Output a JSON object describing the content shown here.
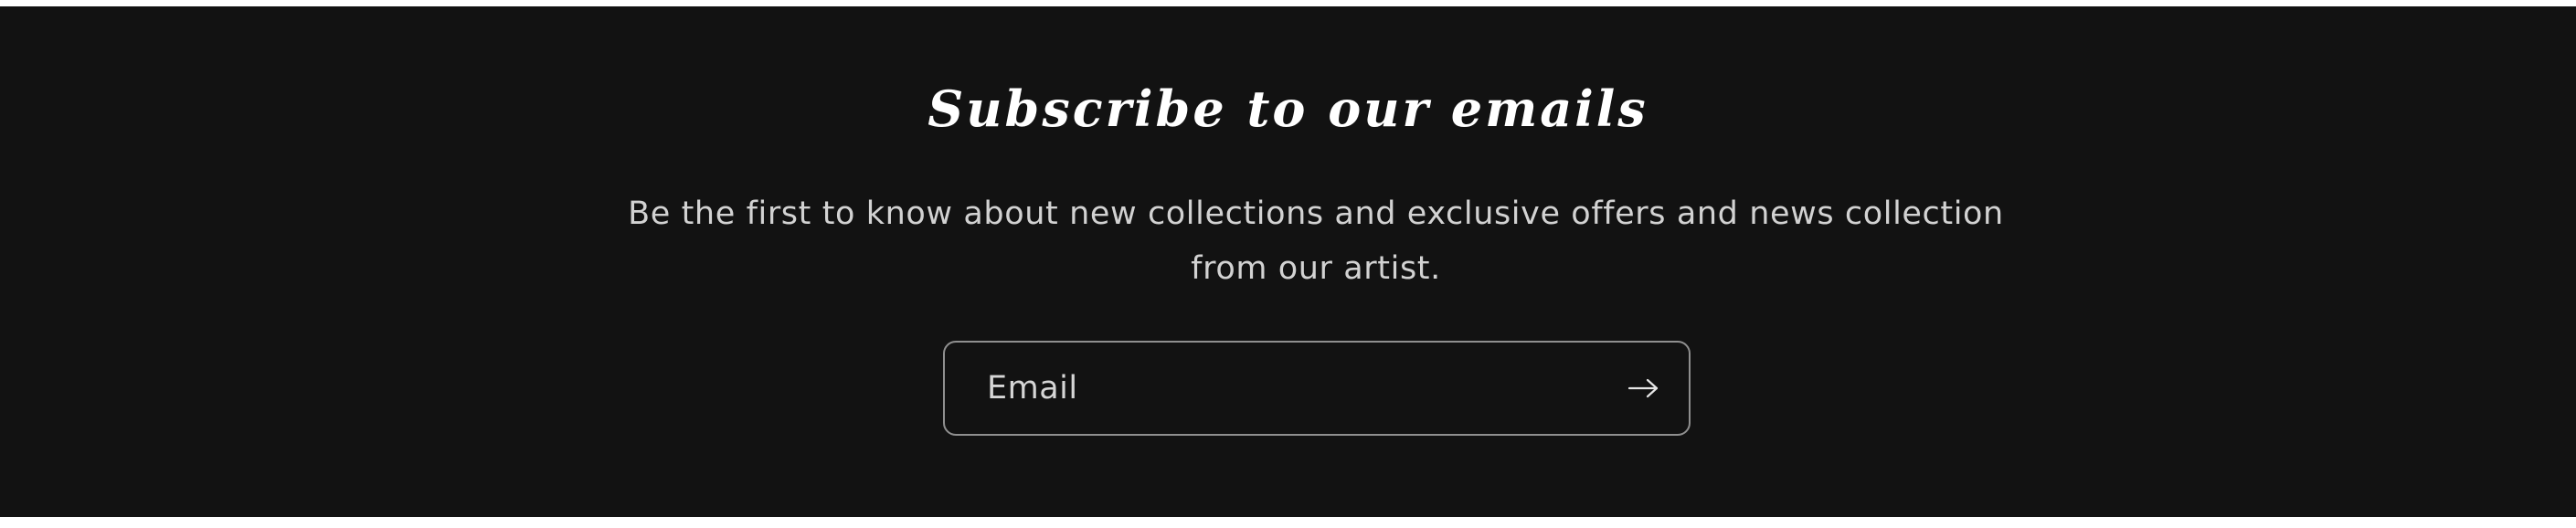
{
  "newsletter": {
    "heading": "Subscribe to our emails",
    "description": "Be the first to know about new collections and exclusive offers and news collection from our artist.",
    "email_placeholder": "Email",
    "submit_icon": "arrow-right-icon",
    "background_color": "#121212",
    "text_color": "#ffffff"
  }
}
